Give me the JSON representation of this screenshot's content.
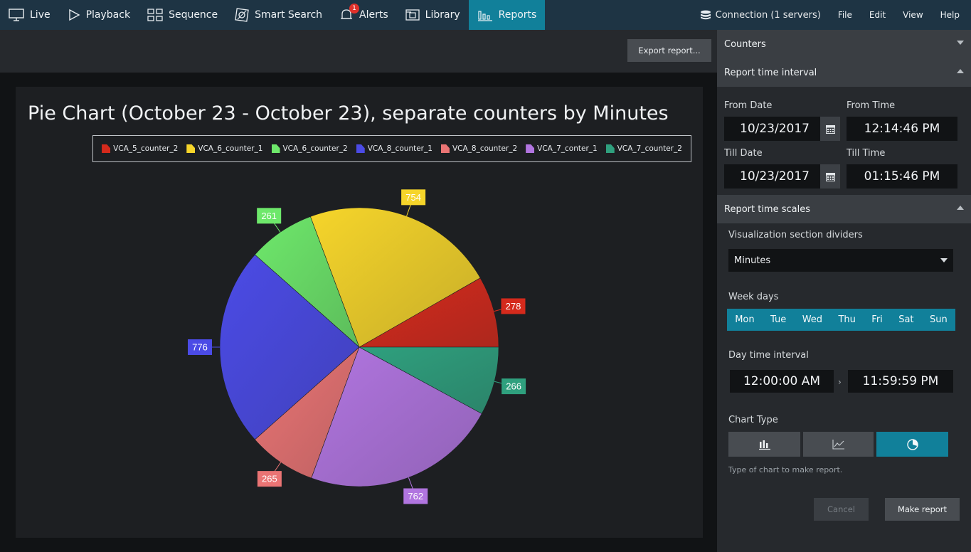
{
  "nav": {
    "items": [
      {
        "label": "Live",
        "icon": "monitor-icon"
      },
      {
        "label": "Playback",
        "icon": "play-icon"
      },
      {
        "label": "Sequence",
        "icon": "grid-icon"
      },
      {
        "label": "Smart Search",
        "icon": "smart-search-icon"
      },
      {
        "label": "Alerts",
        "icon": "bell-icon",
        "badge": "1"
      },
      {
        "label": "Library",
        "icon": "library-icon"
      },
      {
        "label": "Reports",
        "icon": "reports-icon",
        "active": true
      }
    ],
    "connection": "Connection (1 servers)",
    "menus": [
      "File",
      "Edit",
      "View",
      "Help"
    ],
    "active_color": "#11809a"
  },
  "toolbar": {
    "export_label": "Export report..."
  },
  "chart_data": {
    "type": "pie",
    "title": "Pie Chart (October 23 - October 23), separate counters by Minutes",
    "legend_placement": "top",
    "series": [
      {
        "name": "VCA_5_counter_2",
        "value": 278,
        "color": "#d52a1c"
      },
      {
        "name": "VCA_6_counter_1",
        "value": 754,
        "color": "#f6d52a"
      },
      {
        "name": "VCA_6_counter_2",
        "value": 261,
        "color": "#6ee86b"
      },
      {
        "name": "VCA_8_counter_1",
        "value": 776,
        "color": "#4b4be6"
      },
      {
        "name": "VCA_8_counter_2",
        "value": 265,
        "color": "#ea7474"
      },
      {
        "name": "VCA_7_conter_1",
        "value": 762,
        "color": "#b175e0"
      },
      {
        "name": "VCA_7_counter_2",
        "value": 266,
        "color": "#2fa07e"
      }
    ]
  },
  "panel": {
    "counters_header": "Counters",
    "interval_header": "Report time interval",
    "from_date_label": "From Date",
    "from_time_label": "From Time",
    "from_date": "10/23/2017",
    "from_time": "12:14:46 PM",
    "till_date_label": "Till Date",
    "till_time_label": "Till Time",
    "till_date": "10/23/2017",
    "till_time": "01:15:46 PM",
    "scales_header": "Report time scales",
    "dividers_label": "Visualization section dividers",
    "dividers_value": "Minutes",
    "week_days_label": "Week days",
    "week_days": [
      "Mon",
      "Tue",
      "Wed",
      "Thu",
      "Fri",
      "Sat",
      "Sun"
    ],
    "day_interval_label": "Day time interval",
    "day_start": "12:00:00 AM",
    "day_end": "11:59:59 PM",
    "chart_type_label": "Chart Type",
    "chart_types": [
      "bar-chart-icon",
      "line-chart-icon",
      "pie-chart-icon"
    ],
    "chart_type_selected": "pie-chart-icon",
    "hint": "Type of chart to make report.",
    "cancel_label": "Cancel",
    "make_label": "Make report"
  }
}
